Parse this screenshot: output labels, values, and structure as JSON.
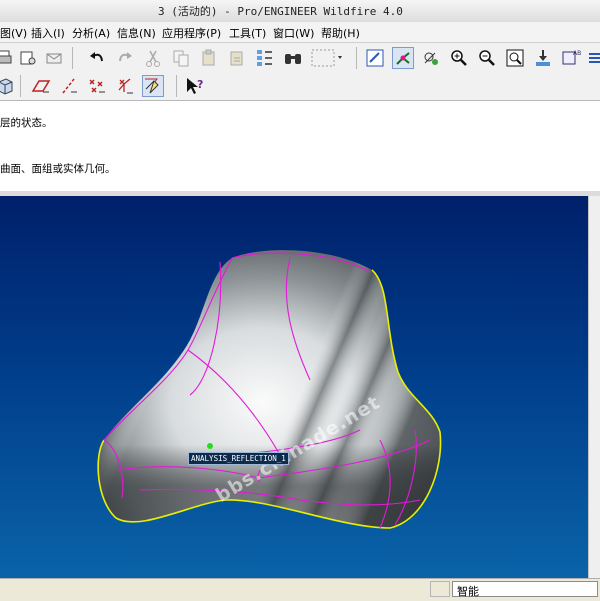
{
  "window": {
    "title": "3 (活动的) - Pro/ENGINEER Wildfire 4.0"
  },
  "menu": [
    {
      "label": "图(V)"
    },
    {
      "label": "插入(I)"
    },
    {
      "label": "分析(A)"
    },
    {
      "label": "信息(N)"
    },
    {
      "label": "应用程序(P)"
    },
    {
      "label": "工具(T)"
    },
    {
      "label": "窗口(W)"
    },
    {
      "label": "帮助(H)"
    }
  ],
  "messages": {
    "line1": "层的状态。",
    "line2": "曲面、面组或实体几何。"
  },
  "viewport": {
    "model_label": "ANALYSIS_REFLECTION_1",
    "watermark": "bbs.chinade.net"
  },
  "status": {
    "filter": "智能"
  },
  "colors": {
    "model_edge": "#e21ad8",
    "silhouette": "#e8f000",
    "background_top": "#00206a",
    "background_bottom": "#0a63a8"
  }
}
